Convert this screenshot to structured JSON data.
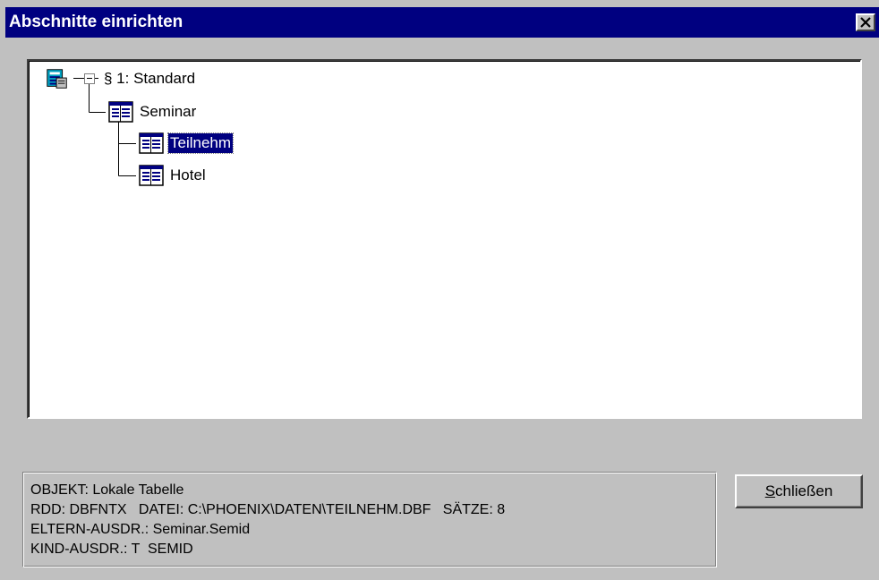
{
  "window": {
    "title": "Abschnitte einrichten",
    "close_icon": "close-icon"
  },
  "tree": {
    "root": {
      "label": "§ 1: Standard",
      "icon": "database-icon",
      "expanded": true
    },
    "children": [
      {
        "label": "Seminar",
        "icon": "table-icon",
        "level": 1
      },
      {
        "label": "Teilnehm",
        "icon": "table-icon",
        "level": 2,
        "selected": true
      },
      {
        "label": "Hotel",
        "icon": "table-icon",
        "level": 2
      }
    ]
  },
  "info": {
    "lines": [
      "OBJEKT: Lokale Tabelle",
      "RDD: DBFNTX   DATEI: C:\\PHOENIX\\DATEN\\TEILNEHM.DBF   SÄTZE: 8",
      "ELTERN-AUSDR.: Seminar.Semid",
      "KIND-AUSDR.: T  SEMID"
    ]
  },
  "buttons": {
    "close_mnemonic": "S",
    "close_rest": "chließen"
  },
  "colors": {
    "titlebar": "#000080",
    "dialog": "#c0c0c0",
    "selection": "#000080"
  }
}
